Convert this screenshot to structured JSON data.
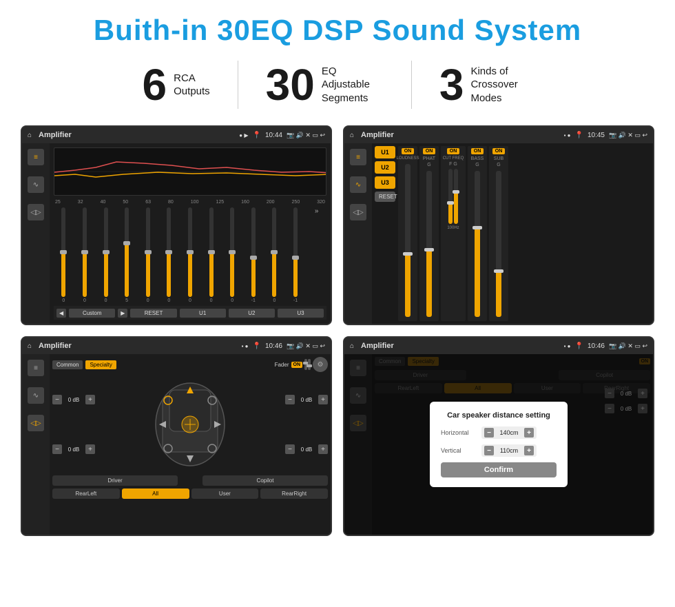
{
  "page": {
    "title": "Buith-in 30EQ DSP Sound System",
    "stats": [
      {
        "number": "6",
        "label": "RCA\nOutputs"
      },
      {
        "number": "30",
        "label": "EQ Adjustable\nSegments"
      },
      {
        "number": "3",
        "label": "Kinds of\nCrossover Modes"
      }
    ]
  },
  "screens": {
    "eq_screen": {
      "title": "Amplifier",
      "time": "10:44",
      "freqs": [
        "25",
        "32",
        "40",
        "50",
        "63",
        "80",
        "100",
        "125",
        "160",
        "200",
        "250",
        "320"
      ],
      "values": [
        "0",
        "0",
        "0",
        "5",
        "0",
        "0",
        "0",
        "0",
        "0",
        "-1",
        "0",
        "-1"
      ],
      "buttons": [
        "◀",
        "Custom",
        "▶",
        "RESET",
        "U1",
        "U2",
        "U3"
      ]
    },
    "crossover_screen": {
      "title": "Amplifier",
      "time": "10:45",
      "u_buttons": [
        "U1",
        "U2",
        "U3"
      ],
      "channels": [
        {
          "label": "LOUDNESS",
          "on": true
        },
        {
          "label": "PHAT",
          "on": true
        },
        {
          "label": "CUT FREQ",
          "on": true
        },
        {
          "label": "BASS",
          "on": true
        },
        {
          "label": "SUB",
          "on": true
        }
      ],
      "reset_label": "RESET"
    },
    "fader_screen": {
      "title": "Amplifier",
      "time": "10:46",
      "mode_buttons": [
        "Common",
        "Specialty"
      ],
      "fader_label": "Fader",
      "on_label": "ON",
      "db_controls": [
        "0 dB",
        "0 dB",
        "0 dB",
        "0 dB"
      ],
      "bottom_buttons": [
        "Driver",
        "",
        "Copilot",
        "RearLeft",
        "All",
        "User",
        "RearRight"
      ]
    },
    "distance_screen": {
      "title": "Amplifier",
      "time": "10:46",
      "dialog": {
        "title": "Car speaker distance setting",
        "horizontal_label": "Horizontal",
        "horizontal_value": "140cm",
        "vertical_label": "Vertical",
        "vertical_value": "110cm",
        "confirm_label": "Confirm"
      },
      "bottom_buttons": [
        "Driver",
        "Copilot",
        "RearLeft",
        "All",
        "User",
        "RearRight"
      ]
    }
  }
}
